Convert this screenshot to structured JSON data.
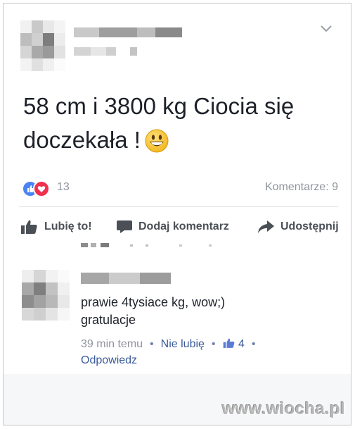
{
  "post": {
    "text": "58 cm i 3800 kg Ciocia się doczekała !",
    "emoji": "grinning-face",
    "reactions_count": "13",
    "comments_count": "Komentarze: 9"
  },
  "actions": {
    "like": "Lubię to!",
    "comment": "Dodaj komentarz",
    "share": "Udostępnij"
  },
  "comment": {
    "text_line1": "prawie 4tysiace kg, wow;)",
    "text_line2": "gratulacje",
    "time": "39 min temu",
    "unlike": "Nie lubię",
    "likes": "4",
    "reply": "Odpowiedz"
  },
  "watermark": "www.wiocha.pl",
  "colors": {
    "text": "#1d2129",
    "secondary": "#90949c",
    "link": "#3b5a9a",
    "like_blue": "#4a83f5",
    "love_red": "#f0304e"
  }
}
